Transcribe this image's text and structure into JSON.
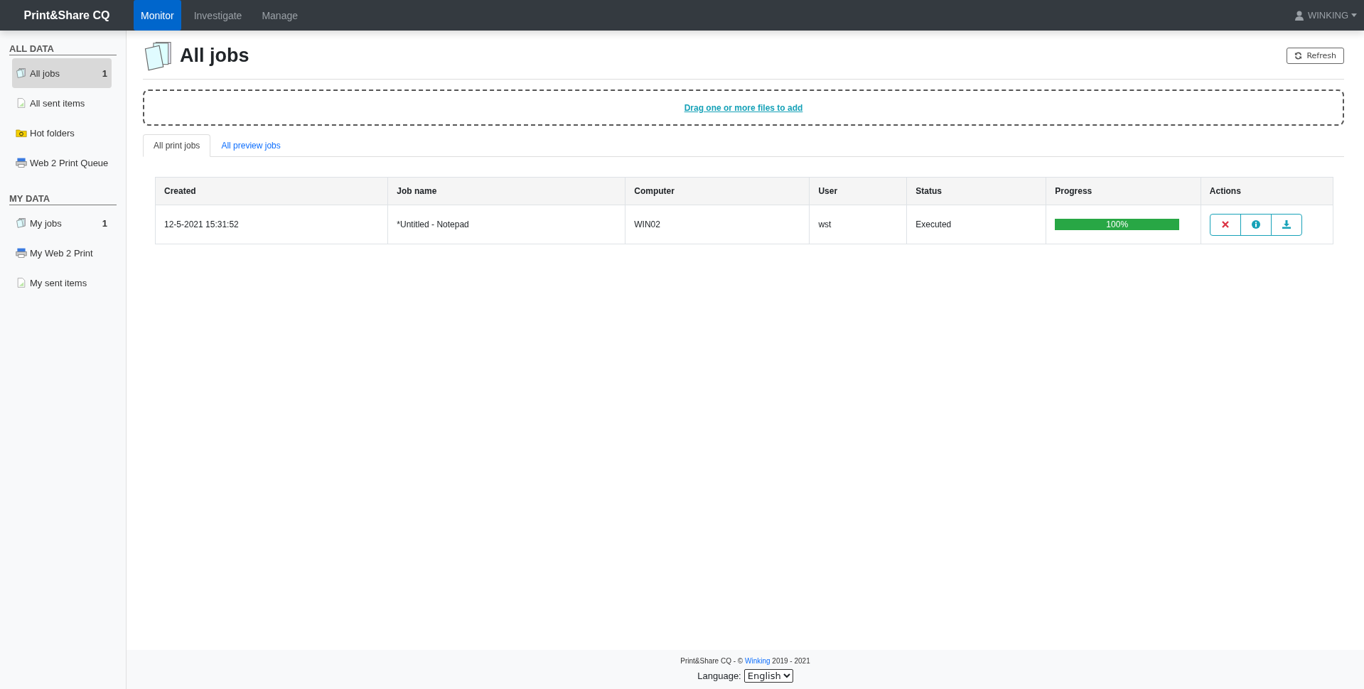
{
  "navbar": {
    "brand": "Print&Share CQ",
    "items": [
      {
        "label": "Monitor",
        "selected": true
      },
      {
        "label": "Investigate",
        "selected": false
      },
      {
        "label": "Manage",
        "selected": false
      }
    ],
    "user": "WINKING"
  },
  "sidebar": {
    "sections": [
      {
        "title": "ALL DATA",
        "items": [
          {
            "label": "All jobs",
            "kind": "jobs",
            "count": "1",
            "selected": true
          },
          {
            "label": "All sent items",
            "kind": "sent",
            "selected": false
          },
          {
            "label": "Hot folders",
            "kind": "folder",
            "selected": false
          },
          {
            "label": "Web 2 Print Queue",
            "kind": "printer",
            "selected": false
          }
        ]
      },
      {
        "title": "MY DATA",
        "items": [
          {
            "label": "My jobs",
            "kind": "jobs",
            "count": "1",
            "selected": false
          },
          {
            "label": "My Web 2 Print",
            "kind": "printer",
            "selected": false
          },
          {
            "label": "My sent items",
            "kind": "sent",
            "selected": false
          }
        ]
      }
    ]
  },
  "page": {
    "title": "All jobs",
    "refresh_button": "Refresh",
    "dropzone": "Drag one or more files to add"
  },
  "tabs": [
    {
      "label": "All print jobs",
      "selected": true
    },
    {
      "label": "All preview jobs",
      "selected": false
    }
  ],
  "table": {
    "columns": [
      "Created",
      "Job name",
      "Computer",
      "User",
      "Status",
      "Progress",
      "Actions"
    ],
    "rows": [
      {
        "created": "12-5-2021 15:31:52",
        "job_name": "*Untitled - Notepad",
        "computer": "WIN02",
        "user": "wst",
        "status": "Executed",
        "level": 1,
        "reading": "100%"
      }
    ]
  },
  "footer": {
    "text_before": "Print&Share CQ - © ",
    "link": "Winking",
    "text_after": " 2019 - 2021",
    "language_label": "Language:",
    "language_value": "English"
  }
}
